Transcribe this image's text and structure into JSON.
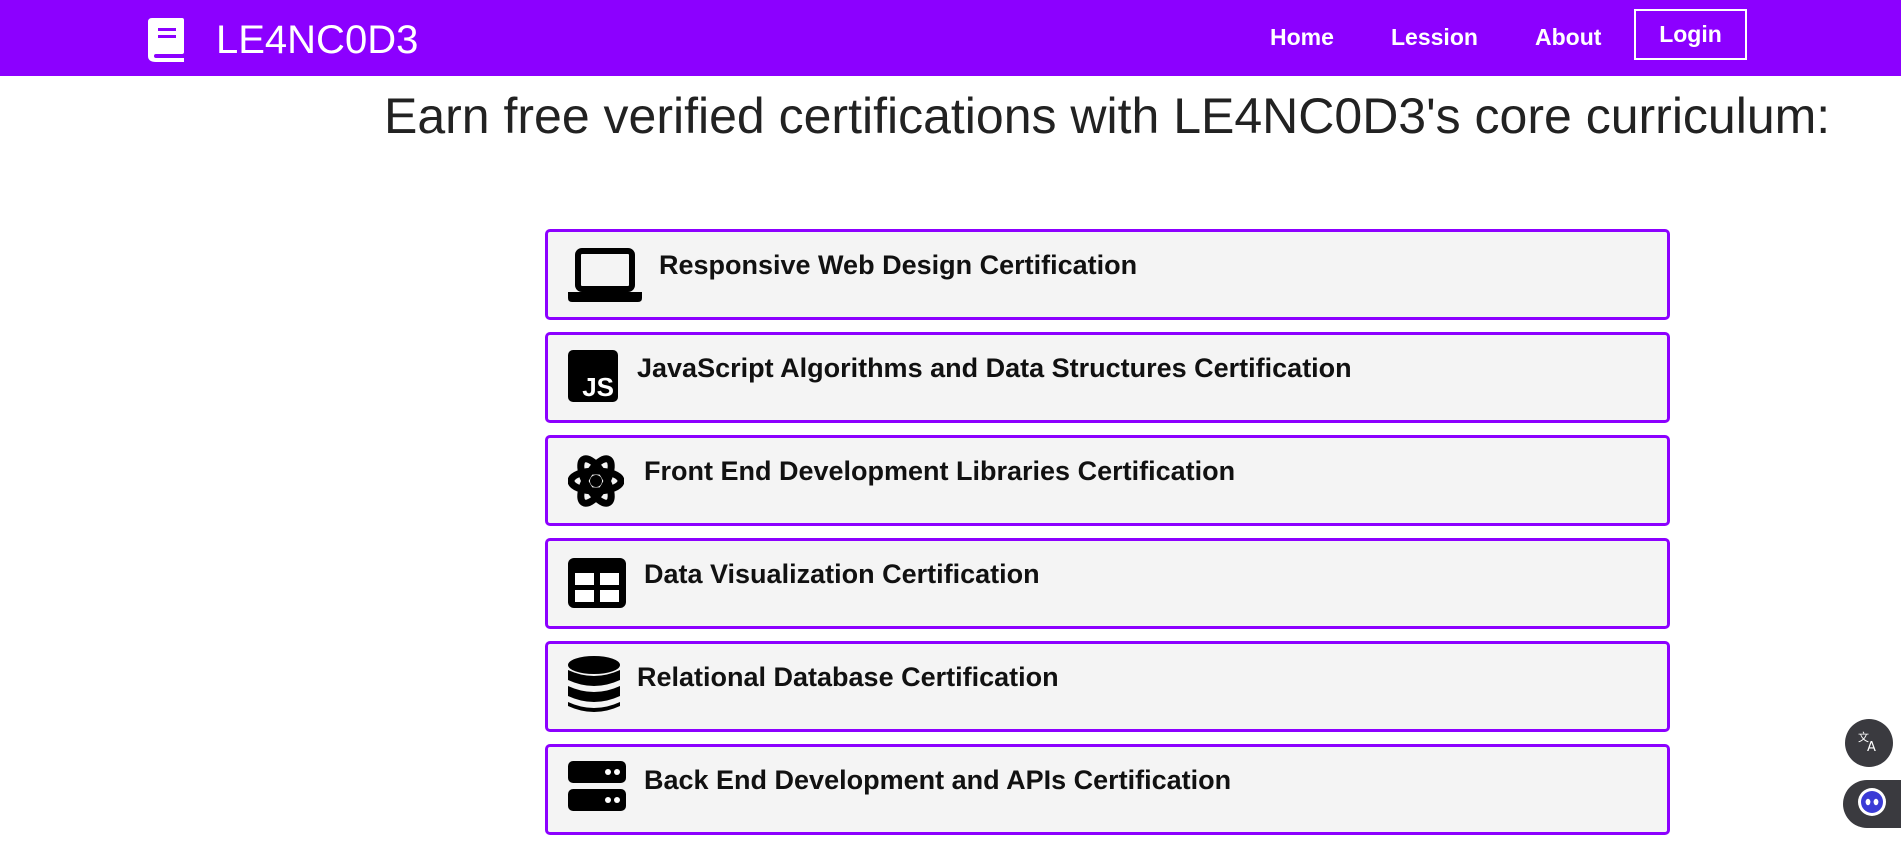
{
  "brand": {
    "name": "LE4NC0D3"
  },
  "nav": {
    "links": [
      {
        "label": "Home"
      },
      {
        "label": "Lession"
      },
      {
        "label": "About"
      }
    ],
    "login_label": "Login"
  },
  "headline": "Earn free verified certifications with LE4NC0D3's core curriculum:",
  "certifications": [
    {
      "label": "Responsive Web Design Certification",
      "icon": "laptop-icon"
    },
    {
      "label": "JavaScript Algorithms and Data Structures Certification",
      "icon": "js-icon"
    },
    {
      "label": "Front End Development Libraries Certification",
      "icon": "react-atom-icon"
    },
    {
      "label": "Data Visualization Certification",
      "icon": "table-icon"
    },
    {
      "label": "Relational Database Certification",
      "icon": "database-icon"
    },
    {
      "label": "Back End Development and APIs Certification",
      "icon": "server-icon"
    }
  ],
  "colors": {
    "navbar": "#8c00ff",
    "card_border": "#8c00ff",
    "card_background": "#f4f4f4"
  },
  "floating_buttons": [
    {
      "icon": "translate-icon"
    },
    {
      "icon": "assistant-bot-icon"
    }
  ]
}
